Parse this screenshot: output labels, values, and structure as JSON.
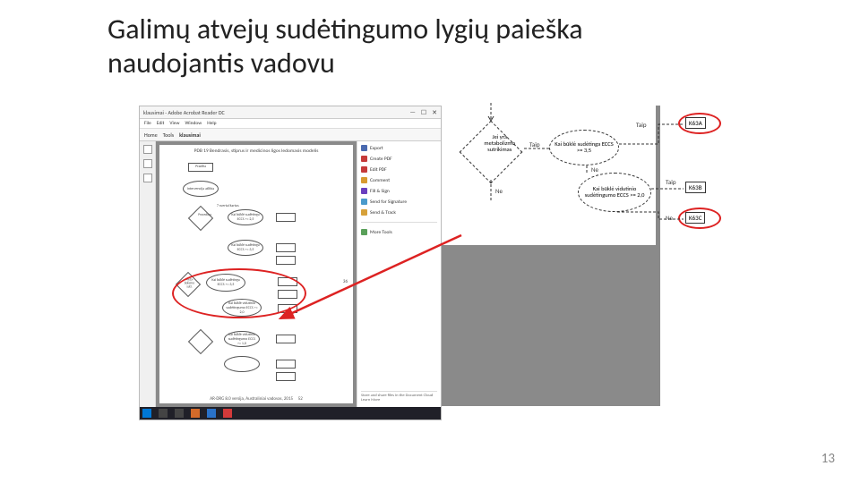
{
  "title_line1": "Galimų atvejų sudėtingumo lygių paieška",
  "title_line2": "naudojantis vadovu",
  "page_number": "13",
  "pdf": {
    "window_title": "klausimai - Adobe Acrobat Reader DC",
    "menu": [
      "File",
      "Edit",
      "View",
      "Window",
      "Help"
    ],
    "tabs": [
      "Home",
      "Tools",
      "klausimai"
    ],
    "page_header": "PDB 19 Bendrasis, stiprus ir medicinos ligos ledomasis modelis",
    "footer": "AR-DRG 8.0 versija, Australiniai vadovas, 2015",
    "page_num_bottom": "52",
    "page_num_right": "36",
    "right_panel": [
      {
        "label": "Export",
        "color": "#4a6ab0"
      },
      {
        "label": "Create PDF",
        "color": "#c53a3a"
      },
      {
        "label": "Edit PDF",
        "color": "#c53a3a"
      },
      {
        "label": "Comment",
        "color": "#d89a2f"
      },
      {
        "label": "Fill & Sign",
        "color": "#6a3fbf"
      },
      {
        "label": "Send for Signature",
        "color": "#4a9acb"
      },
      {
        "label": "Send & Track",
        "color": "#d6a13a"
      },
      {
        "label": "More Tools",
        "color": "#5aa05a"
      }
    ],
    "right_panel_footer": "Store and share files in the\nDocument Cloud\nLearn More"
  },
  "zoom": {
    "diamond1": "Jei yra\nmetabolizmo\nsutrikimas",
    "ell1": "Kai būklė sudėtinga\nECCS >= 3,5",
    "ell2": "Kai būklė vidutinio\nsudėtingumo\nECCS >= 2,0",
    "box1": "K63A",
    "box2": "K63B",
    "box3": "K63C",
    "label_taip": "Taip",
    "label_ne": "Ne"
  },
  "flow_nodes": {
    "start": "Pradžia",
    "ell_inter": "Intervencija atlikta",
    "label_rep": "7 svertai kartus",
    "d1": "Procedūra",
    "e1": "Kai būklė sudėtinga ECCS >= 2,5",
    "e2": "Kai būklė sudėtinga ECCS >= 3,5",
    "e3_dia": "Meta-bolizmo sutr.",
    "e4": "Kai būklė vidutinio sudėtingumo ECCS >= 2,0",
    "e5": "Kai būklė vidutinio sudėtingumo ECCS >= 1,0"
  }
}
